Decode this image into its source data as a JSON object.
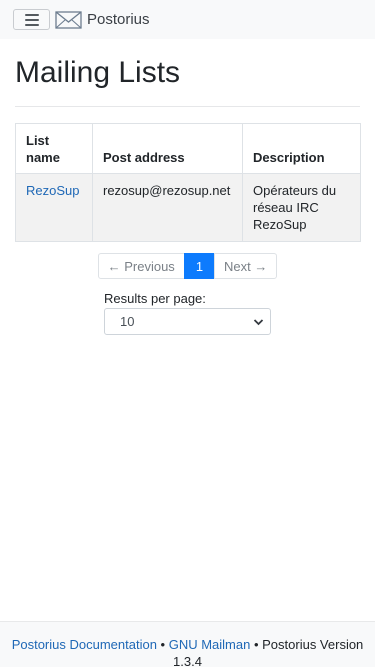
{
  "nav": {
    "brand": "Postorius",
    "menu_icon": "hamburger-menu-icon",
    "logo_icon": "envelope-logo-icon"
  },
  "page": {
    "title": "Mailing Lists"
  },
  "table": {
    "headers": [
      "List name",
      "Post address",
      "Description"
    ],
    "rows": [
      {
        "name": "RezoSup",
        "address": "rezosup@rezosup.net",
        "description": "Opérateurs du réseau IRC RezoSup"
      }
    ]
  },
  "pagination": {
    "previous": "← Previous",
    "current": "1",
    "next": "Next →"
  },
  "results_per_page": {
    "label": "Results per page:",
    "value": "10",
    "icon": "chevron-down-icon"
  },
  "footer": {
    "docs_link": "Postorius Documentation",
    "sep1": " • ",
    "mailman_link": "GNU Mailman",
    "sep2": " • ",
    "version_text": "Postorius Version 1.3.4"
  },
  "colors": {
    "primary": "#0d7bfd",
    "link": "#1f68b6",
    "navbar_bg": "#f8f9fa"
  }
}
